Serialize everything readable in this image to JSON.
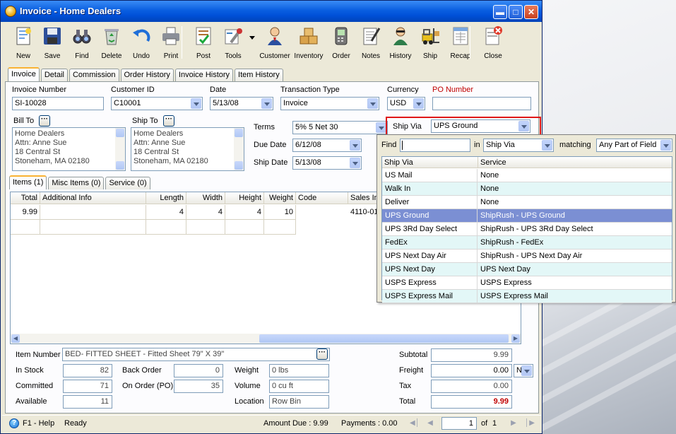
{
  "window": {
    "title": "Invoice - Home Dealers",
    "min_icon": "minimize-icon",
    "max_icon": "maximize-icon",
    "close_icon": "close-icon"
  },
  "toolbar": [
    {
      "label": "New",
      "icon": "new-document-icon"
    },
    {
      "label": "Save",
      "icon": "floppy-disk-icon"
    },
    {
      "label": "Find",
      "icon": "binoculars-icon"
    },
    {
      "label": "Delete",
      "icon": "recycle-bin-icon"
    },
    {
      "label": "Undo",
      "icon": "undo-arrow-icon"
    },
    {
      "label": "Print",
      "icon": "printer-icon"
    },
    {
      "label": "Post",
      "icon": "post-checklist-icon"
    },
    {
      "label": "Tools",
      "icon": "tools-icon"
    },
    {
      "label": "Customer",
      "icon": "customer-person-icon"
    },
    {
      "label": "Inventory",
      "icon": "boxes-icon"
    },
    {
      "label": "Order",
      "icon": "handheld-order-icon"
    },
    {
      "label": "Notes",
      "icon": "notepad-icon"
    },
    {
      "label": "History",
      "icon": "history-person-icon"
    },
    {
      "label": "Ship",
      "icon": "forklift-icon"
    },
    {
      "label": "Recap",
      "icon": "recap-sheet-icon"
    },
    {
      "label": "Close",
      "icon": "close-door-icon"
    }
  ],
  "tabs": [
    "Invoice",
    "Detail",
    "Commission",
    "Order History",
    "Invoice History",
    "Item History"
  ],
  "header": {
    "invoice_number_label": "Invoice Number",
    "invoice_number": "SI-10028",
    "customer_id_label": "Customer ID",
    "customer_id": "C10001",
    "date_label": "Date",
    "date": "5/13/08",
    "transaction_type_label": "Transaction Type",
    "transaction_type": "Invoice",
    "currency_label": "Currency",
    "currency": "USD",
    "po_number_label": "PO Number",
    "po_number": "",
    "bill_to_label": "Bill To",
    "ship_to_label": "Ship To",
    "bill_to": [
      "Home Dealers",
      "Attn: Anne Sue",
      "18 Central St",
      "Stoneham, MA 02180"
    ],
    "ship_to": [
      "Home Dealers",
      "Attn: Anne Sue",
      "18 Central St",
      "Stoneham, MA 02180"
    ],
    "terms_label": "Terms",
    "terms": "5% 5 Net 30",
    "due_date_label": "Due Date",
    "due_date": "6/12/08",
    "ship_date_label": "Ship Date",
    "ship_date": "5/13/08",
    "ship_via_label": "Ship Via",
    "ship_via": "UPS Ground"
  },
  "item_tabs": [
    "Items (1)",
    "Misc Items (0)",
    "Service (0)"
  ],
  "items_grid": {
    "columns": [
      "Total",
      "Additional Info",
      "Length",
      "Width",
      "Height",
      "Weight",
      "Code",
      "Sales In"
    ],
    "rows": [
      [
        "9.99",
        "",
        "4",
        "4",
        "4",
        "10",
        "",
        "4110-01"
      ]
    ]
  },
  "finder": {
    "find_label": "Find",
    "find_value": "",
    "in_label": "in",
    "in_value": "Ship Via",
    "matching_label": "matching",
    "matching_value": "Any Part of Field",
    "columns": [
      "Ship Via",
      "Service"
    ],
    "rows": [
      [
        "US Mail",
        "None"
      ],
      [
        "Walk In",
        "None"
      ],
      [
        "Deliver",
        "None"
      ],
      [
        "UPS Ground",
        "ShipRush - UPS Ground"
      ],
      [
        "UPS 3Rd Day Select",
        "ShipRush - UPS 3Rd Day Select"
      ],
      [
        "FedEx",
        "ShipRush - FedEx"
      ],
      [
        "UPS Next Day Air",
        "ShipRush - UPS Next Day Air"
      ],
      [
        "UPS Next Day",
        "UPS Next Day"
      ],
      [
        "USPS Express",
        "USPS Express"
      ],
      [
        "USPS Express Mail",
        "USPS Express Mail"
      ]
    ],
    "selected_index": 3
  },
  "item_info": {
    "item_number_label": "Item Number",
    "item_number": "BED- FITTED SHEET - Fitted Sheet 79\" X 39\"",
    "in_stock_label": "In Stock",
    "in_stock": "82",
    "committed_label": "Committed",
    "committed": "71",
    "available_label": "Available",
    "available": "11",
    "back_order_label": "Back Order",
    "back_order": "0",
    "on_order_label": "On Order (PO)",
    "on_order": "35",
    "weight_label": "Weight",
    "weight": "0 lbs",
    "volume_label": "Volume",
    "volume": "0 cu ft",
    "location_label": "Location",
    "location": "Row  Bin"
  },
  "totals": {
    "subtotal_label": "Subtotal",
    "subtotal": "9.99",
    "freight_label": "Freight",
    "freight": "0.00",
    "freight_code": "N",
    "tax_label": "Tax",
    "tax": "0.00",
    "total_label": "Total",
    "total": "9.99",
    "total_color": "#c00000"
  },
  "status": {
    "help": "F1 - Help",
    "state": "Ready",
    "amount_due": "Amount Due : 9.99",
    "payments": "Payments : 0.00",
    "page": "1",
    "of_label": "of",
    "page_count": "1"
  }
}
